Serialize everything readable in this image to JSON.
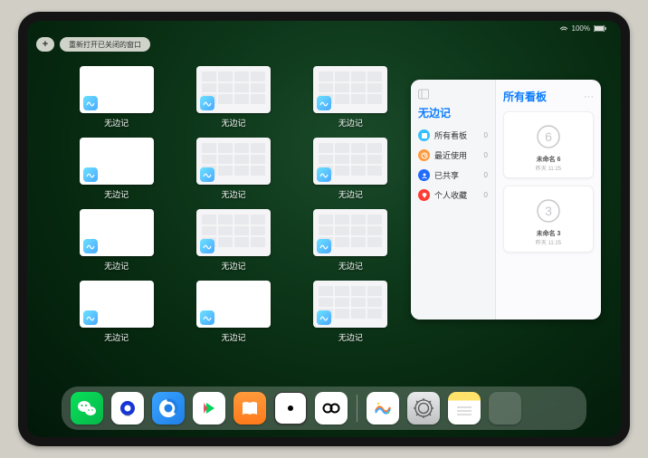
{
  "status": {
    "time": "",
    "battery": "100%"
  },
  "topbar": {
    "plus_label": "+",
    "reopen_label": "重新打开已关闭的窗口"
  },
  "expose": {
    "app_name": "无边记",
    "windows": [
      {
        "label": "无边记",
        "style": "blank"
      },
      {
        "label": "无边记",
        "style": "grid"
      },
      {
        "label": "无边记",
        "style": "grid"
      },
      {
        "label": "无边记",
        "style": "blank"
      },
      {
        "label": "无边记",
        "style": "grid"
      },
      {
        "label": "无边记",
        "style": "grid"
      },
      {
        "label": "无边记",
        "style": "blank"
      },
      {
        "label": "无边记",
        "style": "grid"
      },
      {
        "label": "无边记",
        "style": "grid"
      },
      {
        "label": "无边记",
        "style": "blank"
      },
      {
        "label": "无边记",
        "style": "blank"
      },
      {
        "label": "无边记",
        "style": "grid"
      }
    ]
  },
  "sidepanel": {
    "title": "无边记",
    "right_title": "所有看板",
    "menu_more": "···",
    "items": [
      {
        "label": "所有看板",
        "count": "0",
        "color": "#34c0ff"
      },
      {
        "label": "最近使用",
        "count": "0",
        "color": "#ff9a3c"
      },
      {
        "label": "已共享",
        "count": "0",
        "color": "#1f6bff"
      },
      {
        "label": "个人收藏",
        "count": "0",
        "color": "#ff3b30"
      }
    ],
    "boards": [
      {
        "name": "未命名 6",
        "date": "昨天 11:25",
        "digit": "6"
      },
      {
        "name": "未命名 3",
        "date": "昨天 11:25",
        "digit": "3"
      }
    ]
  },
  "dock": {
    "apps": [
      {
        "name": "wechat"
      },
      {
        "name": "quark"
      },
      {
        "name": "qqbrowser"
      },
      {
        "name": "iqiyi"
      },
      {
        "name": "books"
      },
      {
        "name": "dice"
      },
      {
        "name": "noise"
      }
    ],
    "recent": [
      {
        "name": "freeform"
      },
      {
        "name": "settings"
      },
      {
        "name": "notes"
      },
      {
        "name": "app-library"
      }
    ]
  }
}
